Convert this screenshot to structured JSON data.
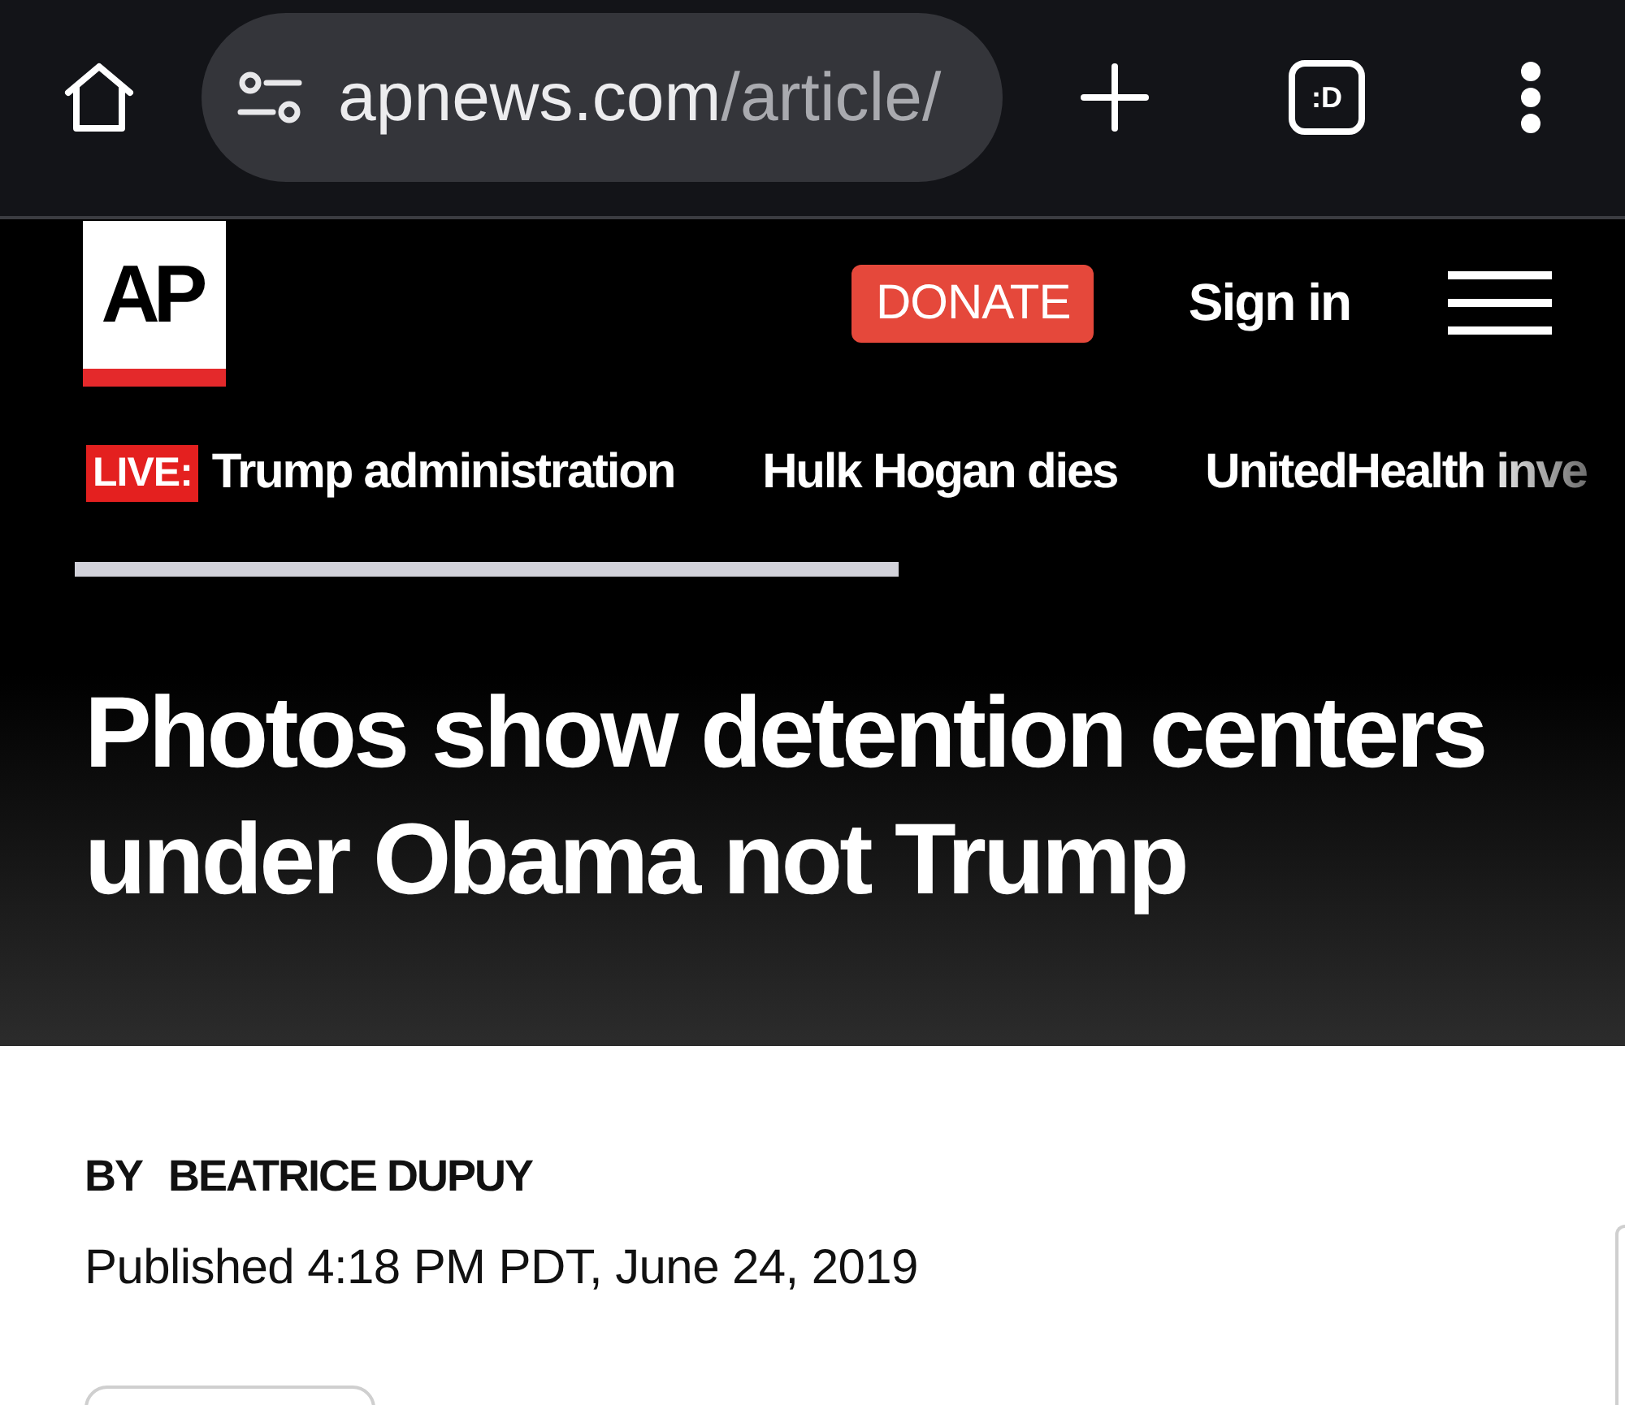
{
  "browser": {
    "url": {
      "host": "apnews.com",
      "path": "/article/"
    },
    "tab_count": ":D"
  },
  "header": {
    "logo": "AP",
    "donate": "DONATE",
    "sign_in": "Sign in"
  },
  "trending": [
    {
      "kind": "live",
      "badge": "LIVE:",
      "label": "Trump administration"
    },
    {
      "kind": "topic",
      "label": "Hulk Hogan dies"
    },
    {
      "kind": "topic",
      "label": "UnitedHealth inve"
    }
  ],
  "article": {
    "headline": "Photos show detention centers under Obama not Trump",
    "byline_prefix": "BY",
    "author": "BEATRICE DUPUY",
    "published": "Published 4:18 PM PDT, June 24, 2019"
  }
}
